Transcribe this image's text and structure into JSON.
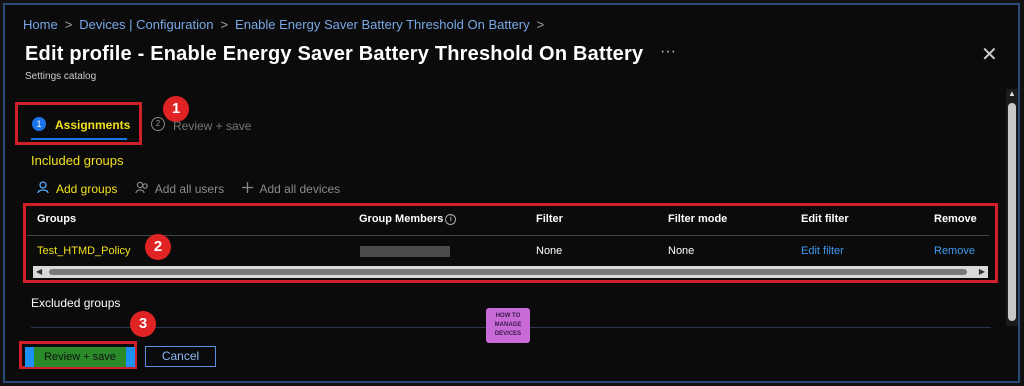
{
  "breadcrumb": {
    "items": [
      "Home",
      "Devices | Configuration",
      "Enable Energy Saver Battery Threshold On Battery"
    ],
    "separator": ">"
  },
  "header": {
    "title": "Edit profile - Enable Energy Saver Battery Threshold On Battery",
    "subtitle": "Settings catalog",
    "more_label": "···",
    "close_label": "✕"
  },
  "steps": [
    {
      "number": "1",
      "label": "Assignments"
    },
    {
      "number": "2",
      "label": "Review + save"
    }
  ],
  "callouts": [
    "1",
    "2",
    "3"
  ],
  "included_groups": {
    "title": "Included groups",
    "toolbar": {
      "add_groups": "Add groups",
      "add_all_users": "Add all users",
      "add_all_devices": "Add all devices"
    },
    "columns": [
      "Groups",
      "Group Members",
      "Filter",
      "Filter mode",
      "Edit filter",
      "Remove"
    ],
    "rows": [
      {
        "group": "Test_HTMD_Policy",
        "filter": "None",
        "filter_mode": "None",
        "edit_filter": "Edit filter",
        "remove": "Remove"
      }
    ]
  },
  "excluded_groups": {
    "title": "Excluded groups"
  },
  "logo": {
    "line1": "HOW TO",
    "line2": "MANAGE",
    "line3": "DEVICES"
  },
  "footer": {
    "review_save": "Review + save",
    "cancel": "Cancel"
  },
  "colors": {
    "accent": "#1a73e8",
    "highlight": "#f2e11d",
    "callout": "#e02424",
    "link": "#3f9bf2"
  }
}
